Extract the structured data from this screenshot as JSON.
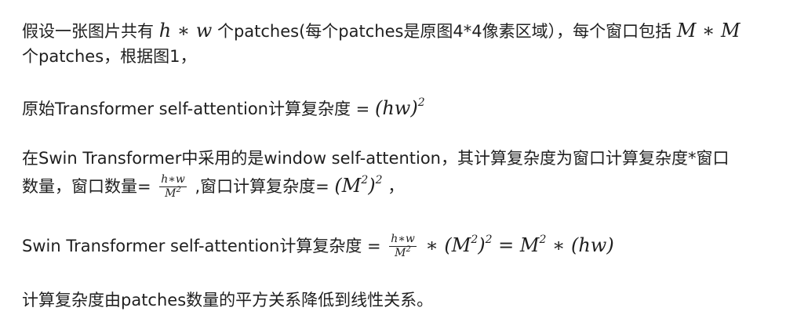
{
  "para1": {
    "prefix": "假设一张图片共有 ",
    "math_hw": "h ∗ w",
    "mid": " 个patches(每个patches是原图4*4像素区域），每个窗口包括 ",
    "math_MM": "M ∗ M",
    "line2": "个patches，根据图1，"
  },
  "para2": {
    "text": "原始Transformer self-attention计算复杂度 = ",
    "math": "(hw)",
    "exp": "2"
  },
  "para3": {
    "line1": "在Swin Transformer中采用的是window self-attention，其计算复杂度为窗口计算复杂度*窗口",
    "line2_prefix": "数量，窗口数量= ",
    "frac_num": "h∗w",
    "frac_den": "M",
    "frac_den_exp": "2",
    "mid": " ,窗口计算复杂度= ",
    "math_open": "(M",
    "math_inner_exp": "2",
    "math_close": ")",
    "math_outer_exp": "2",
    "suffix": " ，"
  },
  "para4": {
    "prefix": "Swin Transformer self-attention计算复杂度 = ",
    "frac_num": "h∗w",
    "frac_den": "M",
    "frac_den_exp": "2",
    "op": " ∗ ",
    "term1_open": "(M",
    "term1_inner_exp": "2",
    "term1_close": ")",
    "term1_outer_exp": "2",
    "eq": " = ",
    "term2_base": "M",
    "term2_exp": "2",
    "term2_rest": " ∗ (hw)"
  },
  "para5": {
    "text": "计算复杂度由patches数量的平方关系降低到线性关系。"
  }
}
